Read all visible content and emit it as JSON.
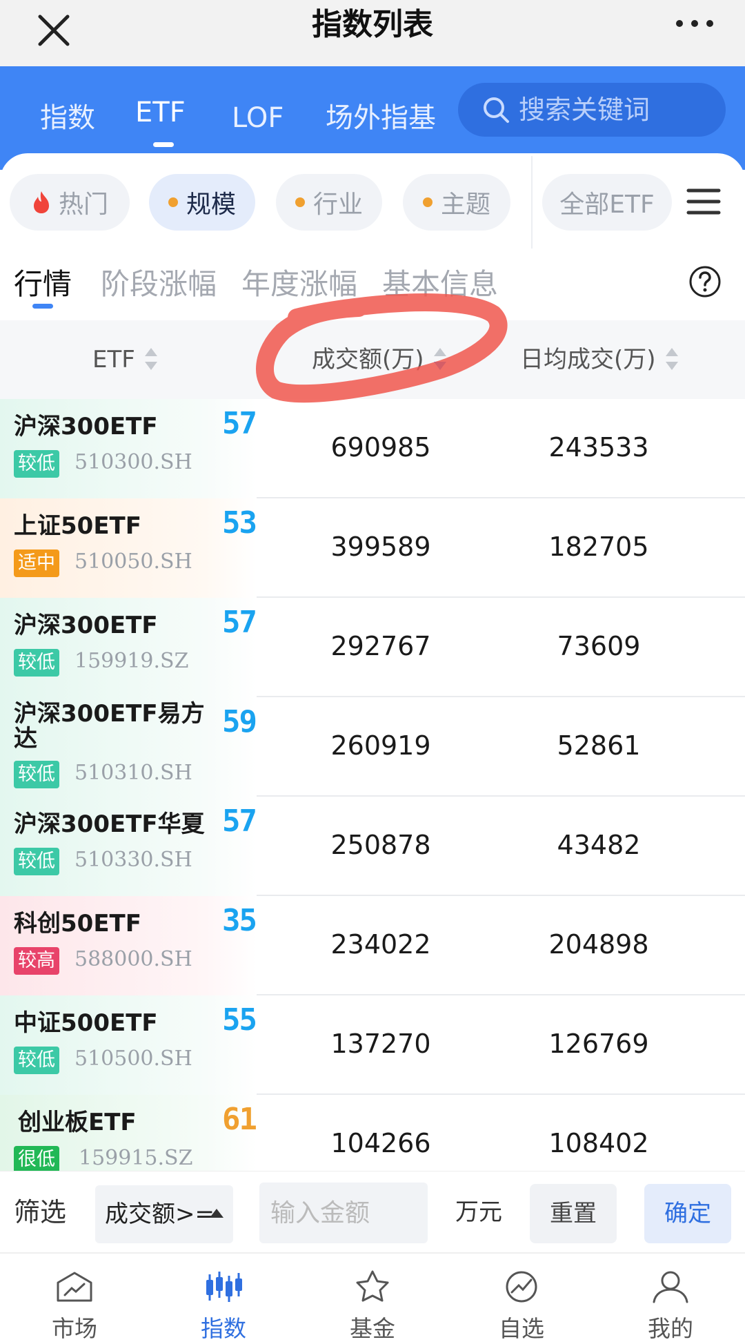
{
  "title_bar": {
    "title": "指数列表"
  },
  "type_tabs": [
    {
      "label": "指数",
      "active": false
    },
    {
      "label": "ETF",
      "active": true
    },
    {
      "label": "LOF",
      "active": false
    },
    {
      "label": "场外指基",
      "active": false
    }
  ],
  "search": {
    "placeholder": "搜索关键词"
  },
  "category_chips": [
    {
      "label": "热门",
      "icon": "fire-icon",
      "active": false
    },
    {
      "label": "规模",
      "icon": "dot",
      "active": true
    },
    {
      "label": "行业",
      "icon": "dot",
      "active": false
    },
    {
      "label": "主题",
      "icon": "dot",
      "active": false
    },
    {
      "label": "全部ETF",
      "icon": "",
      "active": false
    }
  ],
  "sub_tabs": [
    {
      "label": "行情",
      "active": true
    },
    {
      "label": "阶段涨幅",
      "active": false
    },
    {
      "label": "年度涨幅",
      "active": false
    },
    {
      "label": "基本信息",
      "active": false
    }
  ],
  "table": {
    "columns": [
      "ETF",
      "成交额(万)",
      "日均成交(万)"
    ],
    "rows": [
      {
        "name": "沪深300ETF",
        "badge": "较低",
        "code": "510300.SH",
        "score": "57",
        "turnover": "690985",
        "avg_turnover": "243533"
      },
      {
        "name": "上证50ETF",
        "badge": "适中",
        "code": "510050.SH",
        "score": "53",
        "turnover": "399589",
        "avg_turnover": "182705"
      },
      {
        "name": "沪深300ETF",
        "badge": "较低",
        "code": "159919.SZ",
        "score": "57",
        "turnover": "292767",
        "avg_turnover": "73609"
      },
      {
        "name": "沪深300ETF易方达",
        "badge": "较低",
        "code": "510310.SH",
        "score": "59",
        "turnover": "260919",
        "avg_turnover": "52861"
      },
      {
        "name": "沪深300ETF华夏",
        "badge": "较低",
        "code": "510330.SH",
        "score": "57",
        "turnover": "250878",
        "avg_turnover": "43482"
      },
      {
        "name": "科创50ETF",
        "badge": "较高",
        "code": "588000.SH",
        "score": "35",
        "turnover": "234022",
        "avg_turnover": "204898"
      },
      {
        "name": "中证500ETF",
        "badge": "较低",
        "code": "510500.SH",
        "score": "55",
        "turnover": "137270",
        "avg_turnover": "126769"
      },
      {
        "name": "创业板ETF",
        "badge": "很低",
        "code": "159915.SZ",
        "score": "61",
        "turnover": "104266",
        "avg_turnover": "108402"
      }
    ]
  },
  "filter": {
    "label": "筛选",
    "condition": "成交额>=",
    "input_placeholder": "输入金额",
    "unit": "万元",
    "reset_label": "重置",
    "confirm_label": "确定"
  },
  "bottom_nav": [
    {
      "label": "市场",
      "icon": "market-icon",
      "active": false
    },
    {
      "label": "指数",
      "icon": "index-candles-icon",
      "active": true
    },
    {
      "label": "基金",
      "icon": "fund-star-icon",
      "active": false
    },
    {
      "label": "自选",
      "icon": "watchlist-icon",
      "active": false
    },
    {
      "label": "我的",
      "icon": "profile-icon",
      "active": false
    }
  ],
  "colors": {
    "brand_blue": "#3f85f5",
    "badge_low": "#3cc9a6",
    "badge_mid": "#f49a1a",
    "badge_high": "#e8436a",
    "badge_very_low": "#22b856",
    "score_blue": "#1aa3f0",
    "score_orange": "#f0a030"
  }
}
